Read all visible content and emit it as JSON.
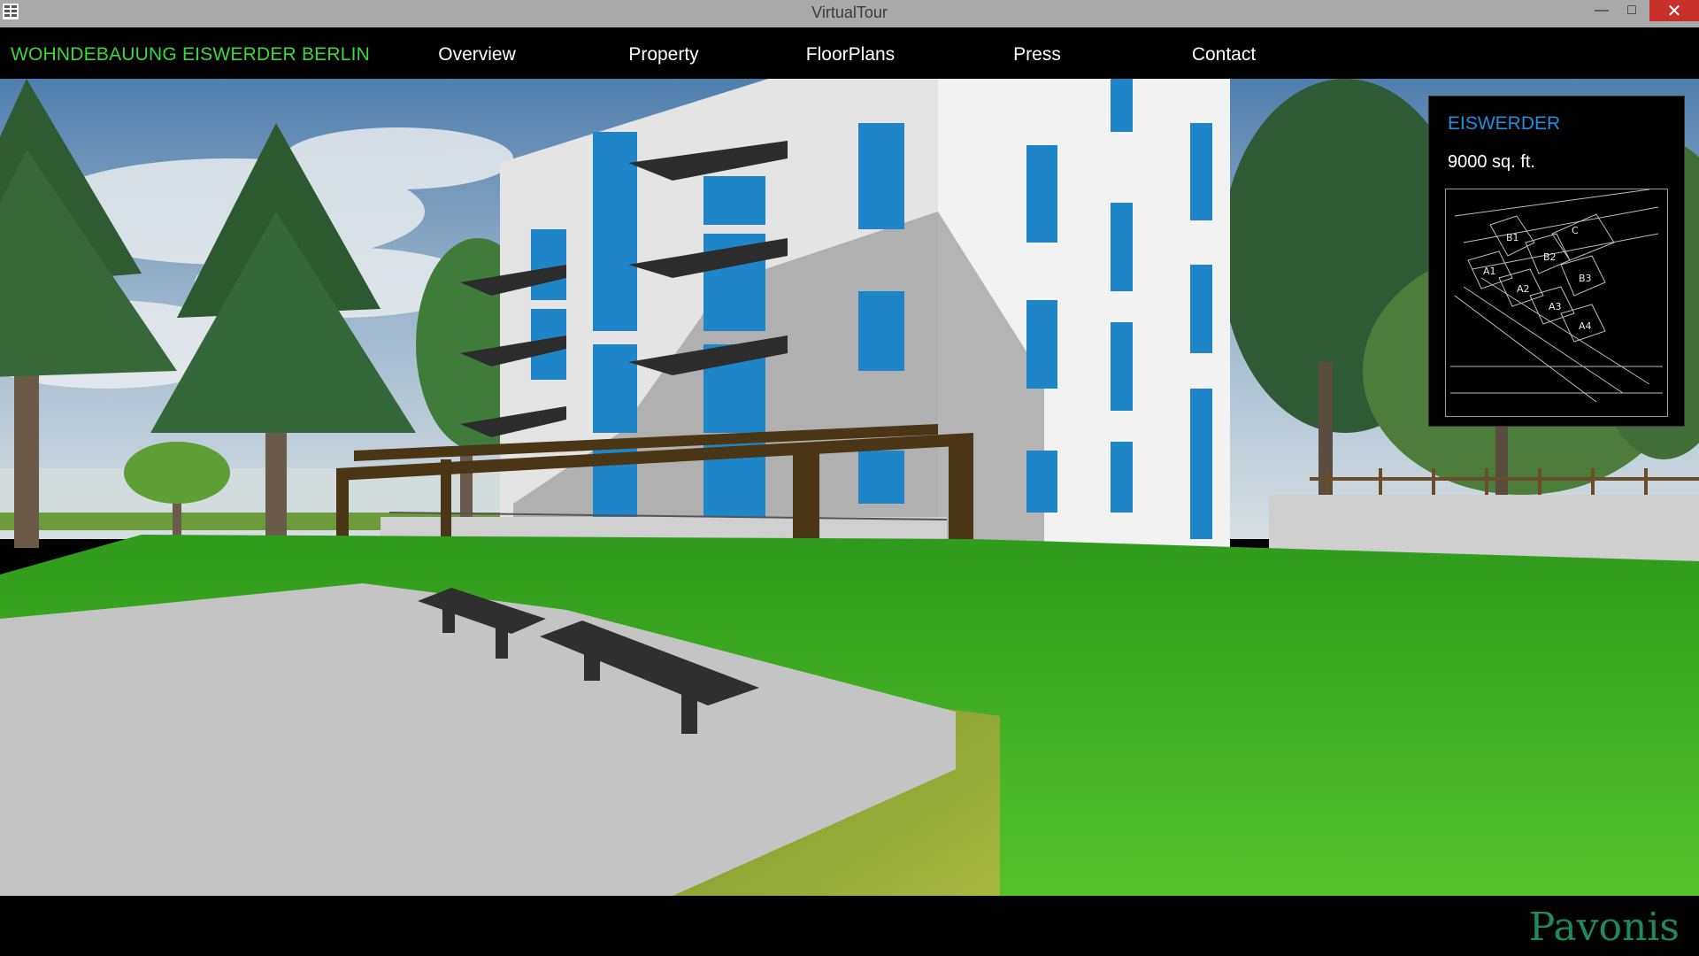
{
  "window": {
    "title": "VirtualTour",
    "minimize_glyph": "—",
    "maximize_glyph": "□",
    "close_glyph": "✕"
  },
  "nav": {
    "brand": "WOHNDEBAUUNG EISWERDER BERLIN",
    "items": [
      {
        "label": "Overview"
      },
      {
        "label": "Property"
      },
      {
        "label": "FloorPlans"
      },
      {
        "label": "Press"
      },
      {
        "label": "Contact"
      }
    ]
  },
  "info_panel": {
    "title": "EISWERDER",
    "area": "9000 sq. ft.",
    "plan_labels": [
      "C",
      "B1",
      "B2",
      "B3",
      "A1",
      "A2",
      "A3",
      "A4"
    ]
  },
  "footer": {
    "logo_text": "Pavonis"
  },
  "colors": {
    "brand_green": "#3ad83a",
    "accent_blue": "#1e90e0",
    "logo_green": "#1f8a5c",
    "close_red": "#c7302b"
  },
  "icons": {
    "app": "grid-app-icon"
  }
}
